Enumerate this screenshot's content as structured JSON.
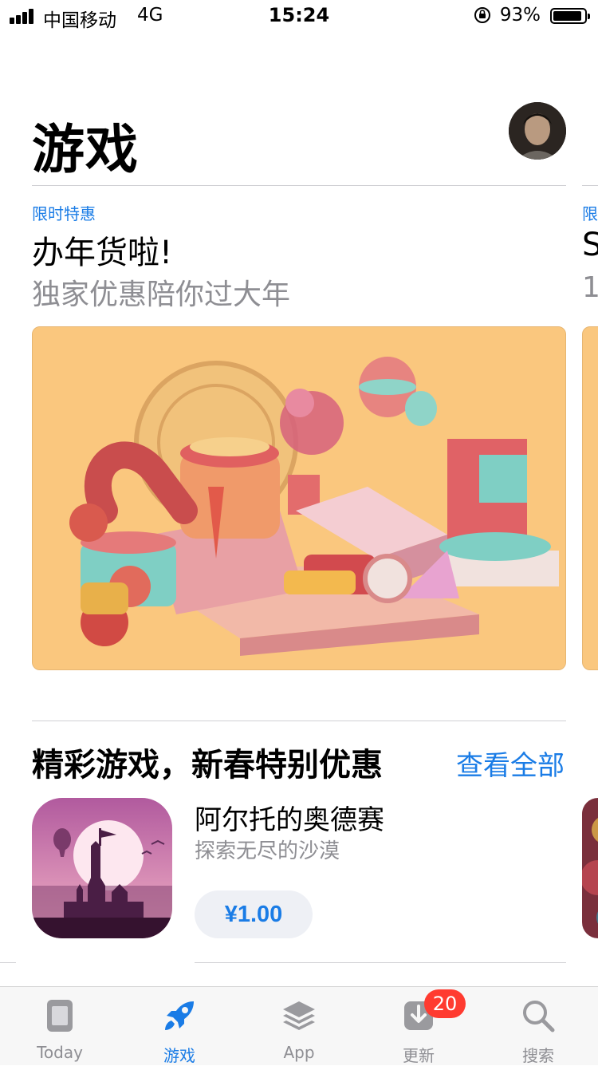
{
  "status_bar": {
    "carrier": "中国移动",
    "network": "4G",
    "time": "15:24",
    "battery_percent": "93%",
    "battery_level": 0.93
  },
  "header": {
    "title": "游戏"
  },
  "featured": {
    "tag": "限时特惠",
    "title": "办年货啦!",
    "subtitle": "独家优惠陪你过大年",
    "next_tag": "限",
    "next_title": "S",
    "next_subtitle": "1"
  },
  "section": {
    "title": "精彩游戏，新春特别优惠",
    "see_all": "查看全部",
    "app": {
      "name": "阿尔托的奥德赛",
      "subtitle": "探索无尽的沙漠",
      "price": "¥1.00"
    }
  },
  "tabbar": {
    "tabs": [
      {
        "label": "Today",
        "icon": "today-icon",
        "active": false
      },
      {
        "label": "游戏",
        "icon": "rocket-icon",
        "active": true
      },
      {
        "label": "App",
        "icon": "layers-icon",
        "active": false
      },
      {
        "label": "更新",
        "icon": "download-icon",
        "active": false
      },
      {
        "label": "搜索",
        "icon": "search-icon",
        "active": false
      }
    ],
    "updates_badge": "20"
  },
  "colors": {
    "accent": "#1a7ce6",
    "badge": "#ff3b30",
    "secondary_text": "#8e8e93",
    "banner_bg": "#fac77e"
  }
}
